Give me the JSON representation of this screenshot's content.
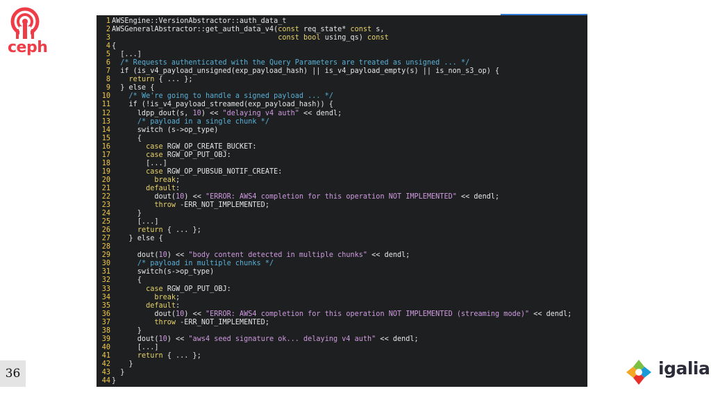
{
  "brand": {
    "ceph_word": "ceph",
    "igalia_word": "igalia",
    "ceph_color": "#ef3d48",
    "code_bg": "#1d1f21",
    "line_number_color": "#f2c84b",
    "comment_color": "#5ab0d6",
    "string_color": "#cf9adf",
    "keyword_color": "#e8d26a"
  },
  "slide": {
    "page_number": "36"
  },
  "code": {
    "lines": [
      {
        "n": "1",
        "parts": [
          [
            "t",
            "AWSEngine::VersionAbstractor::auth_data_t"
          ]
        ]
      },
      {
        "n": "2",
        "parts": [
          [
            "t",
            "AWSGeneralAbstractor::get_auth_data_v4("
          ],
          [
            "k",
            "const"
          ],
          [
            "t",
            " req_state* "
          ],
          [
            "k",
            "const"
          ],
          [
            "t",
            " s,"
          ]
        ]
      },
      {
        "n": "3",
        "parts": [
          [
            "t",
            "                                       "
          ],
          [
            "k",
            "const"
          ],
          [
            "t",
            " "
          ],
          [
            "k",
            "bool"
          ],
          [
            "t",
            " using_qs) "
          ],
          [
            "k",
            "const"
          ]
        ]
      },
      {
        "n": "4",
        "parts": [
          [
            "t",
            "{"
          ]
        ]
      },
      {
        "n": "5",
        "parts": [
          [
            "t",
            "  [...]"
          ]
        ]
      },
      {
        "n": "6",
        "parts": [
          [
            "t",
            "  "
          ],
          [
            "c",
            "/* Requests authenticated with the Query Parameters are treated as unsigned ... */"
          ]
        ]
      },
      {
        "n": "7",
        "parts": [
          [
            "t",
            "  if (is_v4_payload_unsigned(exp_payload_hash) || is_v4_payload_empty(s) || is_non_s3_op) {"
          ]
        ]
      },
      {
        "n": "8",
        "parts": [
          [
            "t",
            "    "
          ],
          [
            "k",
            "return"
          ],
          [
            "t",
            " { ... };"
          ]
        ]
      },
      {
        "n": "9",
        "parts": [
          [
            "t",
            "  } else {"
          ]
        ]
      },
      {
        "n": "10",
        "parts": [
          [
            "t",
            "    "
          ],
          [
            "c",
            "/* We're going to handle a signed payload ... */"
          ]
        ]
      },
      {
        "n": "11",
        "parts": [
          [
            "t",
            "    if (!is_v4_payload_streamed(exp_payload_hash)) {"
          ]
        ]
      },
      {
        "n": "12",
        "parts": [
          [
            "t",
            "      ldpp_dout(s, "
          ],
          [
            "s",
            "10"
          ],
          [
            "t",
            ") << "
          ],
          [
            "s",
            "\"delaying v4 auth\""
          ],
          [
            "t",
            " << dendl;"
          ]
        ]
      },
      {
        "n": "13",
        "parts": [
          [
            "t",
            "      "
          ],
          [
            "c",
            "/* payload in a single chunk */"
          ]
        ]
      },
      {
        "n": "14",
        "parts": [
          [
            "t",
            "      switch (s->op_type)"
          ]
        ]
      },
      {
        "n": "15",
        "parts": [
          [
            "t",
            "      {"
          ]
        ]
      },
      {
        "n": "16",
        "parts": [
          [
            "t",
            "        "
          ],
          [
            "k",
            "case"
          ],
          [
            "t",
            " RGW_OP_CREATE_BUCKET:"
          ]
        ]
      },
      {
        "n": "17",
        "parts": [
          [
            "t",
            "        "
          ],
          [
            "k",
            "case"
          ],
          [
            "t",
            " RGW_OP_PUT_OBJ:"
          ]
        ]
      },
      {
        "n": "18",
        "parts": [
          [
            "t",
            "        [...]"
          ]
        ]
      },
      {
        "n": "19",
        "parts": [
          [
            "t",
            "        "
          ],
          [
            "k",
            "case"
          ],
          [
            "t",
            " RGW_OP_PUBSUB_NOTIF_CREATE:"
          ]
        ]
      },
      {
        "n": "20",
        "parts": [
          [
            "t",
            "          "
          ],
          [
            "k",
            "break"
          ],
          [
            "t",
            ";"
          ]
        ]
      },
      {
        "n": "21",
        "parts": [
          [
            "t",
            "        "
          ],
          [
            "k",
            "default"
          ],
          [
            "t",
            ":"
          ]
        ]
      },
      {
        "n": "22",
        "parts": [
          [
            "t",
            "          dout("
          ],
          [
            "s",
            "10"
          ],
          [
            "t",
            ") << "
          ],
          [
            "s",
            "\"ERROR: AWS4 completion for this operation NOT IMPLEMENTED\""
          ],
          [
            "t",
            " << dendl;"
          ]
        ]
      },
      {
        "n": "23",
        "parts": [
          [
            "t",
            "          "
          ],
          [
            "k",
            "throw"
          ],
          [
            "t",
            " -ERR_NOT_IMPLEMENTED;"
          ]
        ]
      },
      {
        "n": "24",
        "parts": [
          [
            "t",
            "      }"
          ]
        ]
      },
      {
        "n": "25",
        "parts": [
          [
            "t",
            "      [...]"
          ]
        ]
      },
      {
        "n": "26",
        "parts": [
          [
            "t",
            "      "
          ],
          [
            "k",
            "return"
          ],
          [
            "t",
            " { ... };"
          ]
        ]
      },
      {
        "n": "27",
        "parts": [
          [
            "t",
            "    } else {"
          ]
        ]
      },
      {
        "n": "28",
        "parts": [
          [
            "t",
            ""
          ]
        ]
      },
      {
        "n": "29",
        "parts": [
          [
            "t",
            "      dout("
          ],
          [
            "s",
            "10"
          ],
          [
            "t",
            ") << "
          ],
          [
            "s",
            "\"body content detected in multiple chunks\""
          ],
          [
            "t",
            " << dendl;"
          ]
        ]
      },
      {
        "n": "30",
        "parts": [
          [
            "t",
            "      "
          ],
          [
            "c",
            "/* payload in multiple chunks */"
          ]
        ]
      },
      {
        "n": "31",
        "parts": [
          [
            "t",
            "      switch(s->op_type)"
          ]
        ]
      },
      {
        "n": "32",
        "parts": [
          [
            "t",
            "      {"
          ]
        ]
      },
      {
        "n": "33",
        "parts": [
          [
            "t",
            "        "
          ],
          [
            "k",
            "case"
          ],
          [
            "t",
            " RGW_OP_PUT_OBJ:"
          ]
        ]
      },
      {
        "n": "34",
        "parts": [
          [
            "t",
            "          "
          ],
          [
            "k",
            "break"
          ],
          [
            "t",
            ";"
          ]
        ]
      },
      {
        "n": "35",
        "parts": [
          [
            "t",
            "        "
          ],
          [
            "k",
            "default"
          ],
          [
            "t",
            ":"
          ]
        ]
      },
      {
        "n": "36",
        "parts": [
          [
            "t",
            "          dout("
          ],
          [
            "s",
            "10"
          ],
          [
            "t",
            ") << "
          ],
          [
            "s",
            "\"ERROR: AWS4 completion for this operation NOT IMPLEMENTED (streaming mode)\""
          ],
          [
            "t",
            " << dendl;"
          ]
        ]
      },
      {
        "n": "37",
        "parts": [
          [
            "t",
            "          "
          ],
          [
            "k",
            "throw"
          ],
          [
            "t",
            " -ERR_NOT_IMPLEMENTED;"
          ]
        ]
      },
      {
        "n": "38",
        "parts": [
          [
            "t",
            "      }"
          ]
        ]
      },
      {
        "n": "39",
        "parts": [
          [
            "t",
            "      dout("
          ],
          [
            "s",
            "10"
          ],
          [
            "t",
            ") << "
          ],
          [
            "s",
            "\"aws4 seed signature ok... delaying v4 auth\""
          ],
          [
            "t",
            " << dendl;"
          ]
        ]
      },
      {
        "n": "40",
        "parts": [
          [
            "t",
            "      [...]"
          ]
        ]
      },
      {
        "n": "41",
        "parts": [
          [
            "t",
            "      "
          ],
          [
            "k",
            "return"
          ],
          [
            "t",
            " { ... };"
          ]
        ]
      },
      {
        "n": "42",
        "parts": [
          [
            "t",
            "    }"
          ]
        ]
      },
      {
        "n": "43",
        "parts": [
          [
            "t",
            "  }"
          ]
        ]
      },
      {
        "n": "44",
        "parts": [
          [
            "t",
            "}"
          ]
        ]
      }
    ]
  }
}
